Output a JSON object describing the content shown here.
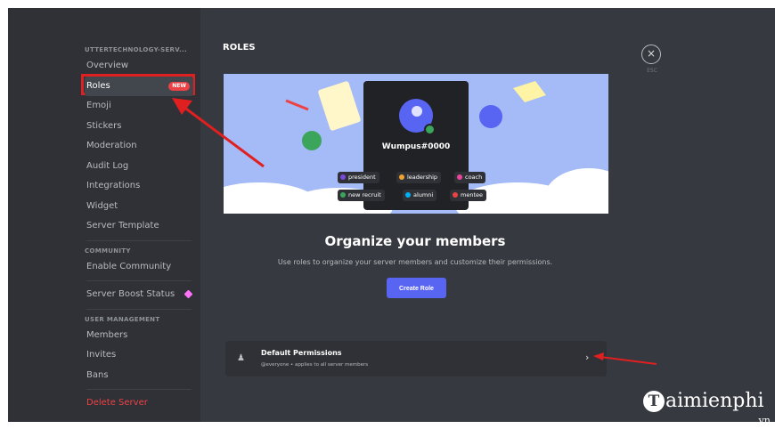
{
  "sidebar": {
    "server_category": "UTTERTECHNOLOGY-SERV...",
    "items_main": [
      "Overview",
      "Roles",
      "Emoji",
      "Stickers",
      "Moderation",
      "Audit Log",
      "Integrations",
      "Widget",
      "Server Template"
    ],
    "roles_badge": "NEW",
    "community_category": "COMMUNITY",
    "enable_community": "Enable Community",
    "server_boost": "Server Boost Status",
    "user_mgmt_category": "USER MANAGEMENT",
    "items_users": [
      "Members",
      "Invites",
      "Bans"
    ],
    "delete_server": "Delete Server",
    "active_item": "Roles"
  },
  "header": {
    "title": "ROLES",
    "close_label": "ESC",
    "close_glyph": "×"
  },
  "banner": {
    "username": "Wumpus#0000",
    "roles": [
      {
        "name": "president",
        "color": "#7a4ad9"
      },
      {
        "name": "leadership",
        "color": "#f0a232"
      },
      {
        "name": "coach",
        "color": "#eb459e"
      },
      {
        "name": "new recruit",
        "color": "#3ba55c"
      },
      {
        "name": "alumni",
        "color": "#00b0f4"
      },
      {
        "name": "mentee",
        "color": "#ed4245"
      }
    ]
  },
  "main": {
    "title": "Organize your members",
    "description": "Use roles to organize your server members and customize their permissions.",
    "create_button": "Create Role"
  },
  "default_permissions": {
    "title": "Default Permissions",
    "subtitle": "@everyone • applies to all server members",
    "chevron": "›"
  },
  "watermark": {
    "brand_initial": "T",
    "brand_rest": "aimienphi",
    "tld": ".vn"
  },
  "colors": {
    "accent": "#5865f2",
    "annotation_red": "#e02020",
    "danger": "#ed4245"
  }
}
